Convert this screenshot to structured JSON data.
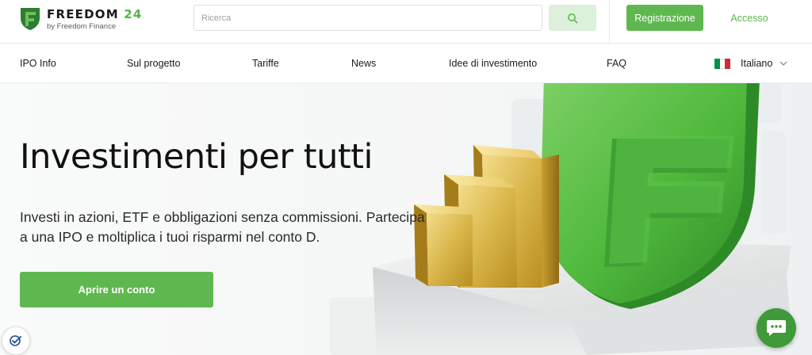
{
  "header": {
    "brand_name": "FREEDOM",
    "brand_number": "24",
    "brand_subtitle": "by Freedom Finance",
    "search_placeholder": "Ricerca",
    "search_icon": "search-icon",
    "register_label": "Registrazione",
    "login_label": "Accesso"
  },
  "nav": {
    "items": [
      {
        "label": "IPO Info"
      },
      {
        "label": "Sul progetto"
      },
      {
        "label": "Tariffe"
      },
      {
        "label": "News"
      },
      {
        "label": "Idee di investimento"
      },
      {
        "label": "FAQ"
      }
    ],
    "language": {
      "label": "Italiano",
      "flag_icon": "italy-flag-icon",
      "chevron_icon": "chevron-down-icon"
    }
  },
  "hero": {
    "title": "Investimenti per tutti",
    "subtitle": "Investi in azioni, ETF e obbligazioni senza commissioni. Partecipa a una IPO e moltiplica i tuoi risparmi nel conto D.",
    "cta_label": "Aprire un conto"
  },
  "widgets": {
    "chat_icon": "chat-bubble-icon",
    "cookie_icon": "cookie-consent-icon"
  },
  "colors": {
    "brand_green": "#5fb84f",
    "brand_dark_green": "#2e7d32",
    "search_button_bg": "#dcf0dc",
    "chat_green": "#3f9a3a",
    "gold": "#d9b64a",
    "flag_green": "#009246",
    "flag_white": "#ffffff",
    "flag_red": "#ce2b37"
  }
}
